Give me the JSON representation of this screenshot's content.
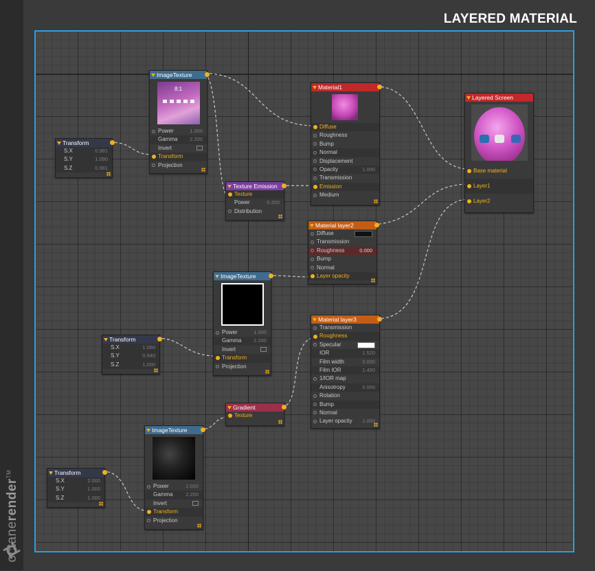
{
  "title": "LAYERED MATERIAL",
  "brand": {
    "word_regular": "octane",
    "word_bold": "render",
    "tm": "TM"
  },
  "nodes": {
    "imgtex1": {
      "title": "ImageTexture",
      "clock": "8:1",
      "rows": [
        {
          "label": "Power",
          "value": "1.000"
        },
        {
          "label": "Gamma",
          "value": "2.200"
        },
        {
          "label": "Invert"
        },
        {
          "label": "Transform"
        },
        {
          "label": "Projection"
        }
      ]
    },
    "transform1": {
      "title": "Transform",
      "rows": [
        {
          "label": "S.X",
          "value": "0.981"
        },
        {
          "label": "S.Y",
          "value": "1.090"
        },
        {
          "label": "S.Z",
          "value": "0.981"
        }
      ]
    },
    "material1": {
      "title": "Material1",
      "rows": [
        {
          "label": "Diffuse"
        },
        {
          "label": "Roughness"
        },
        {
          "label": "Bump"
        },
        {
          "label": "Normal"
        },
        {
          "label": "Displacement"
        },
        {
          "label": "Opacity",
          "value": "1.000"
        },
        {
          "label": "Transmission"
        },
        {
          "label": "Emission"
        },
        {
          "label": "Medium"
        }
      ]
    },
    "layered": {
      "title": "Layered Screen",
      "rows": [
        {
          "label": "Base material"
        },
        {
          "label": "Layer1"
        },
        {
          "label": "Layer2"
        }
      ]
    },
    "emission": {
      "title": "Texture Emission",
      "rows": [
        {
          "label": "Texture"
        },
        {
          "label": "Power",
          "value": "0.200"
        },
        {
          "label": "Distribution"
        }
      ]
    },
    "layer2": {
      "title": "Material layer2",
      "rows": [
        {
          "label": "Diffuse"
        },
        {
          "label": "Transmission"
        },
        {
          "label": "Roughness",
          "value": "0.000"
        },
        {
          "label": "Bump"
        },
        {
          "label": "Normal"
        },
        {
          "label": "Layer opacity"
        }
      ]
    },
    "imgtex2": {
      "title": "ImageTexture",
      "rows": [
        {
          "label": "Power",
          "value": "1.000"
        },
        {
          "label": "Gamma",
          "value": "2.200"
        },
        {
          "label": "Invert"
        },
        {
          "label": "Transform"
        },
        {
          "label": "Projection"
        }
      ]
    },
    "transform2": {
      "title": "Transform",
      "rows": [
        {
          "label": "S.X",
          "value": "1.060"
        },
        {
          "label": "S.Y",
          "value": "0.940"
        },
        {
          "label": "S.Z",
          "value": "1.000"
        }
      ]
    },
    "layer3": {
      "title": "Material layer3",
      "rows": [
        {
          "label": "Transmission"
        },
        {
          "label": "Roughness"
        },
        {
          "label": "Specular"
        },
        {
          "label": "IOR",
          "value": "1.520"
        },
        {
          "label": "Film width",
          "value": "0.000"
        },
        {
          "label": "Film IOR",
          "value": "1.450"
        },
        {
          "label": "1/IOR map"
        },
        {
          "label": "Anisotropy",
          "value": "0.000"
        },
        {
          "label": "Rotation"
        },
        {
          "label": "Bump"
        },
        {
          "label": "Normal"
        },
        {
          "label": "Layer opacity",
          "value": "1.000"
        }
      ]
    },
    "gradient": {
      "title": "Gradient",
      "rows": [
        {
          "label": "Texture"
        }
      ]
    },
    "imgtex3": {
      "title": "ImageTexture",
      "rows": [
        {
          "label": "Power",
          "value": "2.000"
        },
        {
          "label": "Gamma",
          "value": "2.200"
        },
        {
          "label": "Invert"
        },
        {
          "label": "Transform"
        },
        {
          "label": "Projection"
        }
      ]
    },
    "transform3": {
      "title": "Transform",
      "rows": [
        {
          "label": "S.X",
          "value": "2.000"
        },
        {
          "label": "S.Y",
          "value": "1.000"
        },
        {
          "label": "S.Z",
          "value": "1.000"
        }
      ]
    }
  },
  "colors": {
    "accent_border": "#2f9ee0",
    "pin": "#f2b01e",
    "wire": "#c8c8c8"
  }
}
